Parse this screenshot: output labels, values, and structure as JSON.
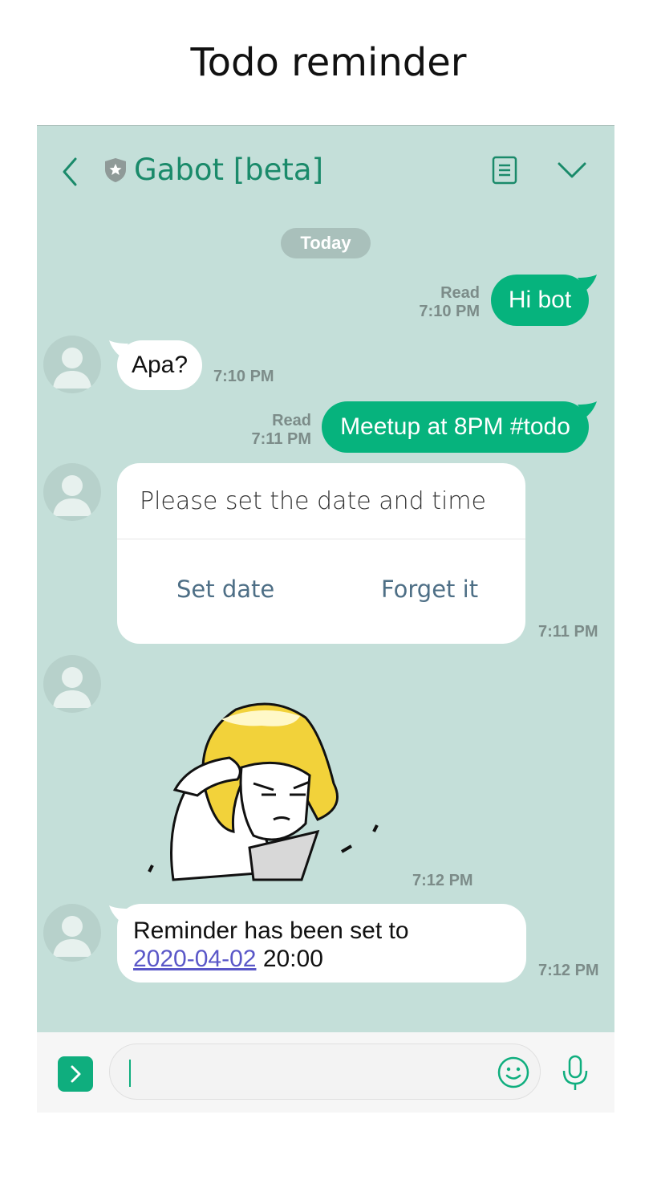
{
  "page_title": "Todo reminder",
  "header": {
    "chat_name": "Gabot [beta]"
  },
  "date_divider": "Today",
  "messages": {
    "m1": {
      "text": "Hi bot",
      "status": "Read",
      "time": "7:10 PM"
    },
    "m2": {
      "text": "Apa?",
      "time": "7:10 PM"
    },
    "m3": {
      "text": "Meetup at 8PM #todo",
      "status": "Read",
      "time": "7:11 PM"
    },
    "card": {
      "text": "Please set the date and time",
      "btn_set": "Set date",
      "btn_forget": "Forget it",
      "time": "7:11 PM"
    },
    "sticker": {
      "time": "7:12 PM"
    },
    "reminder": {
      "line1": "Reminder has been set to",
      "date": "2020-04-02",
      "time_value": "20:00",
      "time": "7:12 PM"
    }
  },
  "input": {
    "placeholder": ""
  },
  "colors": {
    "background": "#c4dfd9",
    "brand": "#1a8a6a",
    "outgoing_bubble": "#06b37d",
    "link": "#5a57c8"
  },
  "icons": [
    "back-icon",
    "shield-icon",
    "menu-icon",
    "chevron-down-icon",
    "plus-icon",
    "emoji-icon",
    "mic-icon"
  ]
}
